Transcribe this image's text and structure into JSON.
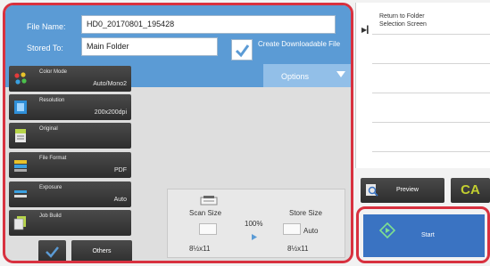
{
  "header": {
    "file_name_label": "File Name:",
    "file_name_value": "HD0_20170801_195428",
    "stored_to_label": "Stored To:",
    "stored_to_value": "Main Folder",
    "download_label": "Create Downloadable File",
    "download_checked": true,
    "options_label": "Options"
  },
  "modes": [
    {
      "title": "Color Mode",
      "value": "Auto/Mono2",
      "icon": "color-mode-icon"
    },
    {
      "title": "Resolution",
      "value": "200x200dpi",
      "icon": "resolution-icon"
    },
    {
      "title": "Original",
      "value": "",
      "icon": "original-icon"
    },
    {
      "title": "File Format",
      "value": "PDF",
      "icon": "file-format-icon"
    },
    {
      "title": "Exposure",
      "value": "Auto",
      "icon": "exposure-icon"
    },
    {
      "title": "Job Build",
      "value": "",
      "icon": "job-build-icon"
    }
  ],
  "others_label": "Others",
  "size": {
    "scan_label": "Scan Size",
    "scan_value": "8½x11",
    "ratio": "100%",
    "store_label": "Store Size",
    "store_mode": "Auto",
    "store_value": "8½x11"
  },
  "right_panel": {
    "folder_label_line1": "Return to Folder",
    "folder_label_line2": "Selection Screen"
  },
  "preview_label": "Preview",
  "ca_label": "CA",
  "start_label": "Start",
  "colors": {
    "accent": "#5b9bd5",
    "highlight": "#d8313f",
    "start_button": "#3a73c2",
    "ca_text": "#c3cf2f"
  }
}
